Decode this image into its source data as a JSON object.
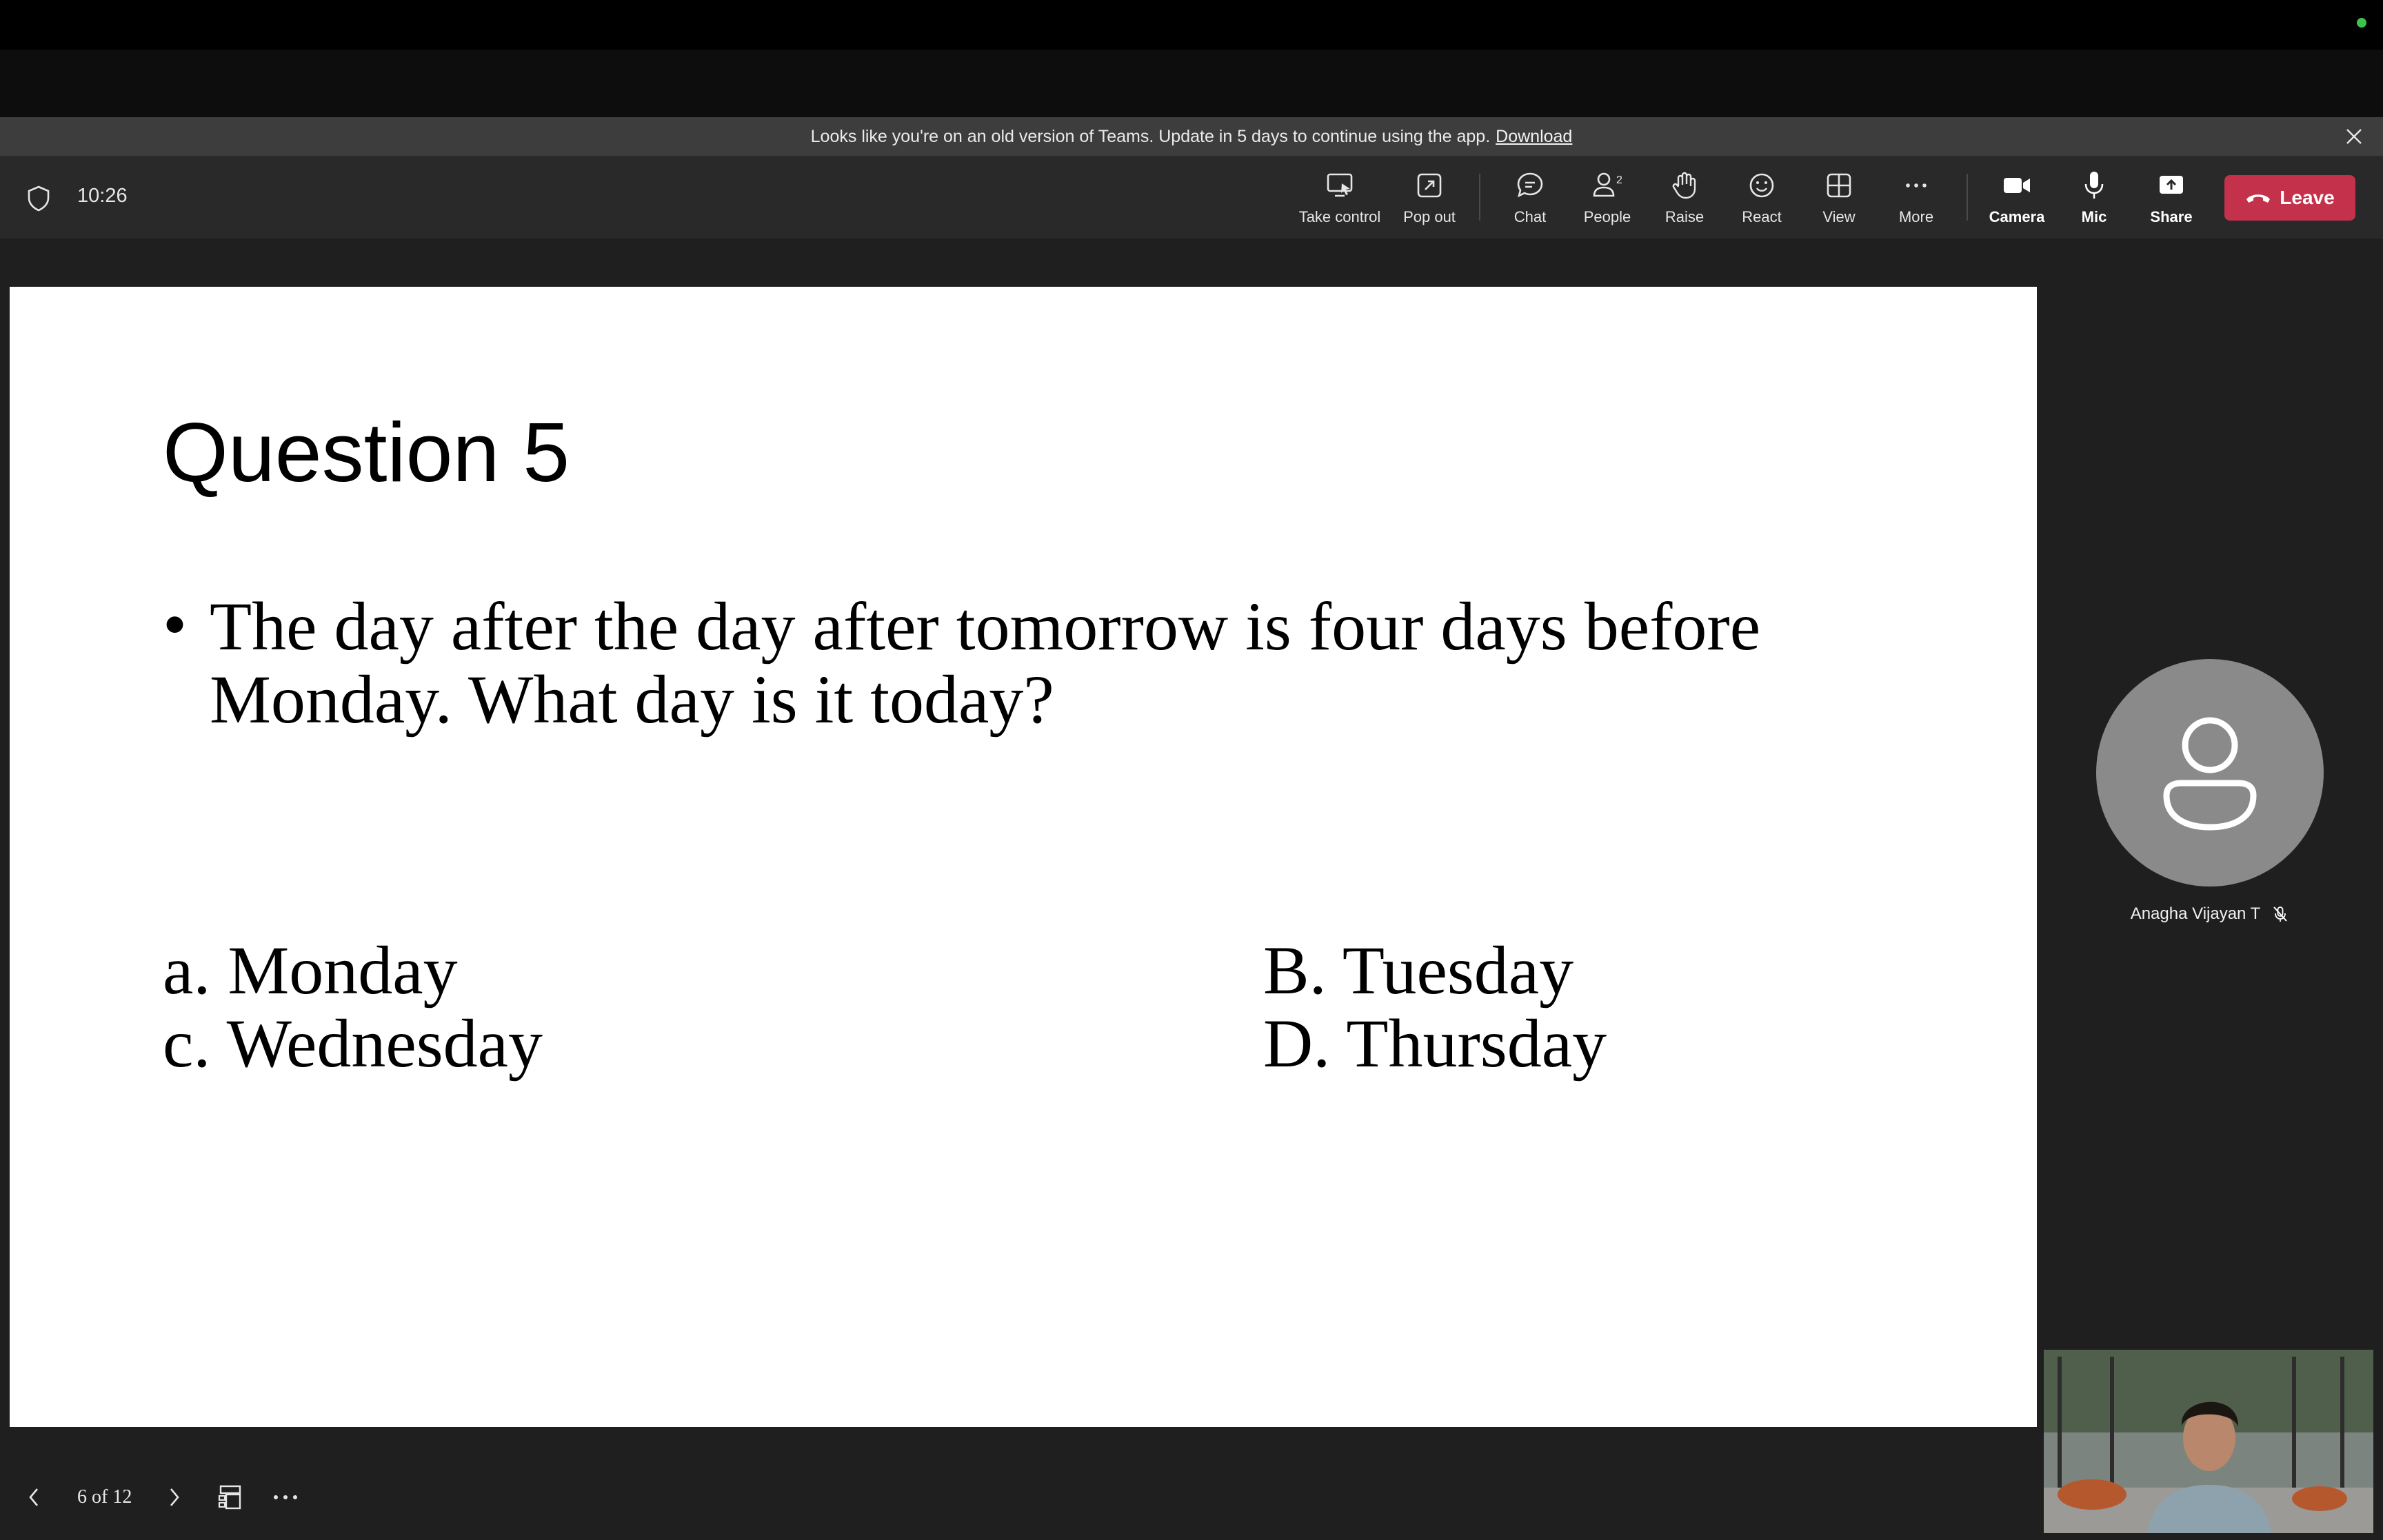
{
  "banner": {
    "message": "Looks like you're on an old version of Teams. Update in 5 days to continue using the app.",
    "link": "Download"
  },
  "meeting": {
    "timer": "10:26"
  },
  "toolbar": {
    "take_control": "Take control",
    "pop_out": "Pop out",
    "chat": "Chat",
    "people": "People",
    "people_count": "2",
    "raise": "Raise",
    "react": "React",
    "view": "View",
    "more": "More",
    "camera": "Camera",
    "mic": "Mic",
    "share": "Share",
    "leave": "Leave",
    "leave_color": "#c4314b"
  },
  "slide": {
    "title": "Question 5",
    "bullet": "The day after the day after tomorrow is four days before Monday. What day is it today?",
    "options": {
      "a": "a. Monday",
      "b": "B. Tuesday",
      "c": "c. Wednesday",
      "d": "D. Thursday"
    }
  },
  "participant": {
    "name": "Anagha Vijayan T",
    "muted_icon": "mic-off-icon"
  },
  "pager": {
    "label": "6 of 12"
  }
}
